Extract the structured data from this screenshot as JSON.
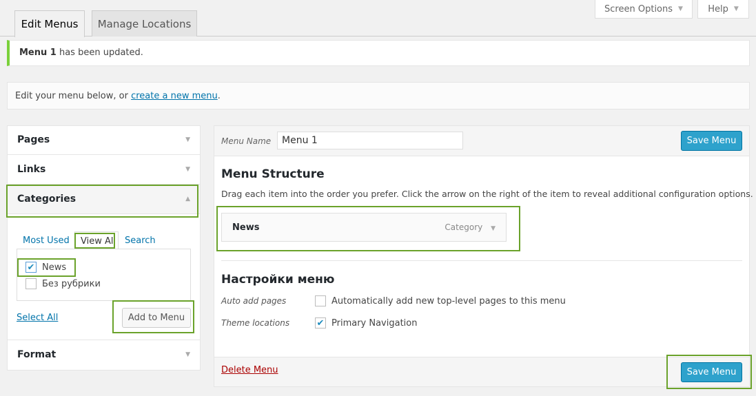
{
  "top": {
    "screen_options": "Screen Options",
    "help": "Help"
  },
  "tabs": [
    "Edit Menus",
    "Manage Locations"
  ],
  "notice": {
    "bold": "Menu 1",
    "text": " has been updated."
  },
  "intro": {
    "text": "Edit your menu below, or ",
    "link": "create a new menu",
    "end": "."
  },
  "sidebar": {
    "pages": "Pages",
    "links": "Links",
    "categories": "Categories",
    "format": "Format",
    "cat_tabs": [
      "Most Used",
      "View All",
      "Search"
    ],
    "items": [
      {
        "label": "News",
        "checked": true
      },
      {
        "label": "Без рубрики",
        "checked": false
      }
    ],
    "select_all": "Select All",
    "add": "Add to Menu"
  },
  "menu": {
    "name_label": "Menu Name",
    "name_value": "Menu 1",
    "save": "Save Menu",
    "structure_title": "Menu Structure",
    "structure_desc": "Drag each item into the order you prefer. Click the arrow on the right of the item to reveal additional configuration options.",
    "item": {
      "title": "News",
      "type": "Category"
    },
    "settings_title": "Настройки меню",
    "auto_label": "Auto add pages",
    "auto_text": "Automatically add new top-level pages to this menu",
    "auto_checked": false,
    "theme_label": "Theme locations",
    "theme_text": "Primary Navigation",
    "theme_checked": true,
    "delete": "Delete Menu"
  },
  "colors": {
    "highlight": "#6aa22a",
    "primary": "#2ea2cc",
    "notice": "#7ad03a"
  }
}
